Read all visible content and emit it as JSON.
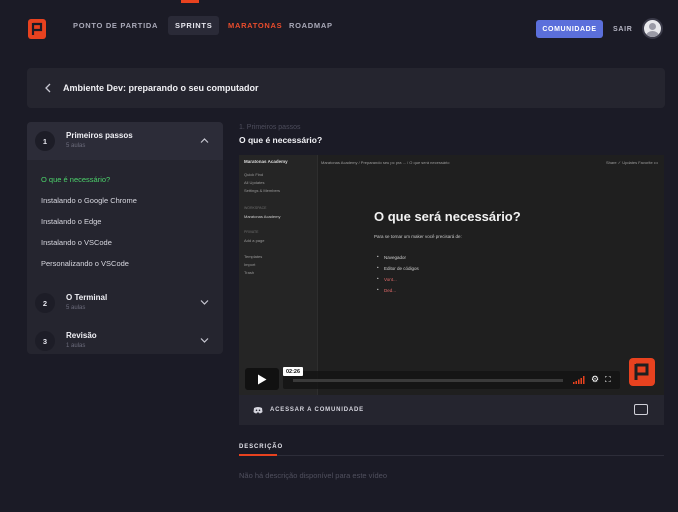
{
  "header": {
    "nav": [
      {
        "label": "PONTO DE PARTIDA",
        "state": "normal"
      },
      {
        "label": "SPRINTS",
        "state": "active"
      },
      {
        "label": "MARATONAS",
        "state": "accent"
      },
      {
        "label": "ROADMAP",
        "state": "normal"
      }
    ],
    "community_label": "COMUNIDADE",
    "logout_label": "SAIR"
  },
  "course": {
    "title": "Ambiente Dev: preparando o seu computador"
  },
  "sidebar": {
    "modules": [
      {
        "number": "1",
        "title": "Primeiros passos",
        "subtitle": "5 aulas",
        "expanded": true
      },
      {
        "number": "2",
        "title": "O Terminal",
        "subtitle": "5 aulas",
        "expanded": false
      },
      {
        "number": "3",
        "title": "Revisão",
        "subtitle": "1 aulas",
        "expanded": false
      }
    ],
    "lessons": [
      {
        "label": "O que é necessário?",
        "current": true
      },
      {
        "label": "Instalando o Google Chrome",
        "current": false
      },
      {
        "label": "Instalando o Edge",
        "current": false
      },
      {
        "label": "Instalando o VSCode",
        "current": false
      },
      {
        "label": "Personalizando o VSCode",
        "current": false
      }
    ]
  },
  "lesson": {
    "breadcrumb": "1. Primeiros passos",
    "title": "O que é necessário?"
  },
  "video": {
    "workspace": "Maratonas Academy",
    "sidebar_items": [
      "Quick Find",
      "All Updates",
      "Settings & Members"
    ],
    "workspace_section": "WORKSPACE",
    "workspace_page": "Maratonas Academy",
    "private_section": "PRIVATE",
    "add_page": "Add a page",
    "footer_items": [
      "Templates",
      "Import",
      "Trash"
    ],
    "topbar_path": "Maratonas Academy / Preparando seu pc pra ... / O que será necessário",
    "topbar_right": "Share  ✓ Updates  Favorite  •••",
    "doc_title": "O que será necessário?",
    "doc_intro": "Para se tornar um maker você precisará de:",
    "doc_items": [
      {
        "text": "Navegador",
        "red": false
      },
      {
        "text": "Editor de códigos",
        "red": false
      },
      {
        "text": "Vont...",
        "red": true
      },
      {
        "text": "Ded...",
        "red": true
      }
    ],
    "timestamp": "02:26",
    "progress": 0.0
  },
  "video_footer": {
    "community_link": "ACESSAR A COMUNIDADE"
  },
  "description": {
    "label": "DESCRIÇÃO",
    "text": "Não há descrição disponível para este vídeo"
  },
  "colors": {
    "accent": "#e8421f",
    "current_lesson": "#4cd26b",
    "community_button": "#5b6fdb"
  }
}
